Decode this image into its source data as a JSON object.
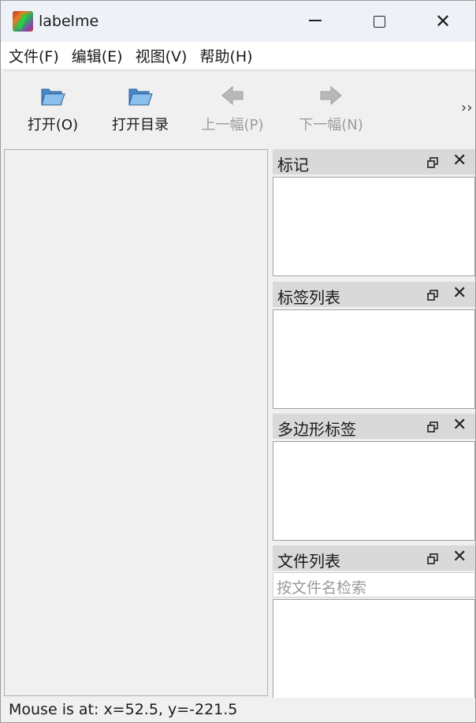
{
  "window": {
    "title": "labelme"
  },
  "menu": [
    {
      "label": "文件(F)"
    },
    {
      "label": "编辑(E)"
    },
    {
      "label": "视图(V)"
    },
    {
      "label": "帮助(H)"
    }
  ],
  "toolbar": {
    "open": "打开(O)",
    "open_dir": "打开目录",
    "prev": "上一幅(P)",
    "next": "下一幅(N)",
    "more": "››"
  },
  "docks": {
    "flags": {
      "title": "标记"
    },
    "label_list": {
      "title": "标签列表"
    },
    "polygon_labels": {
      "title": "多边形标签"
    },
    "file_list": {
      "title": "文件列表",
      "search_placeholder": "按文件名检索"
    }
  },
  "status": {
    "text": "Mouse is at: x=52.5, y=-221.5"
  },
  "icons": {
    "app": "labelme-app-icon",
    "open": "folder-open-icon",
    "open_dir": "folder-open-icon",
    "prev": "arrow-left-icon",
    "next": "arrow-right-icon",
    "float": "float-window-icon",
    "close": "close-icon"
  },
  "colors": {
    "titlebar": "#eef2f8",
    "menubar": "#ffffff",
    "panel_bg": "#f0f0f0",
    "dock_header": "#d9d9d9",
    "disabled_text": "#9c9c9c"
  }
}
